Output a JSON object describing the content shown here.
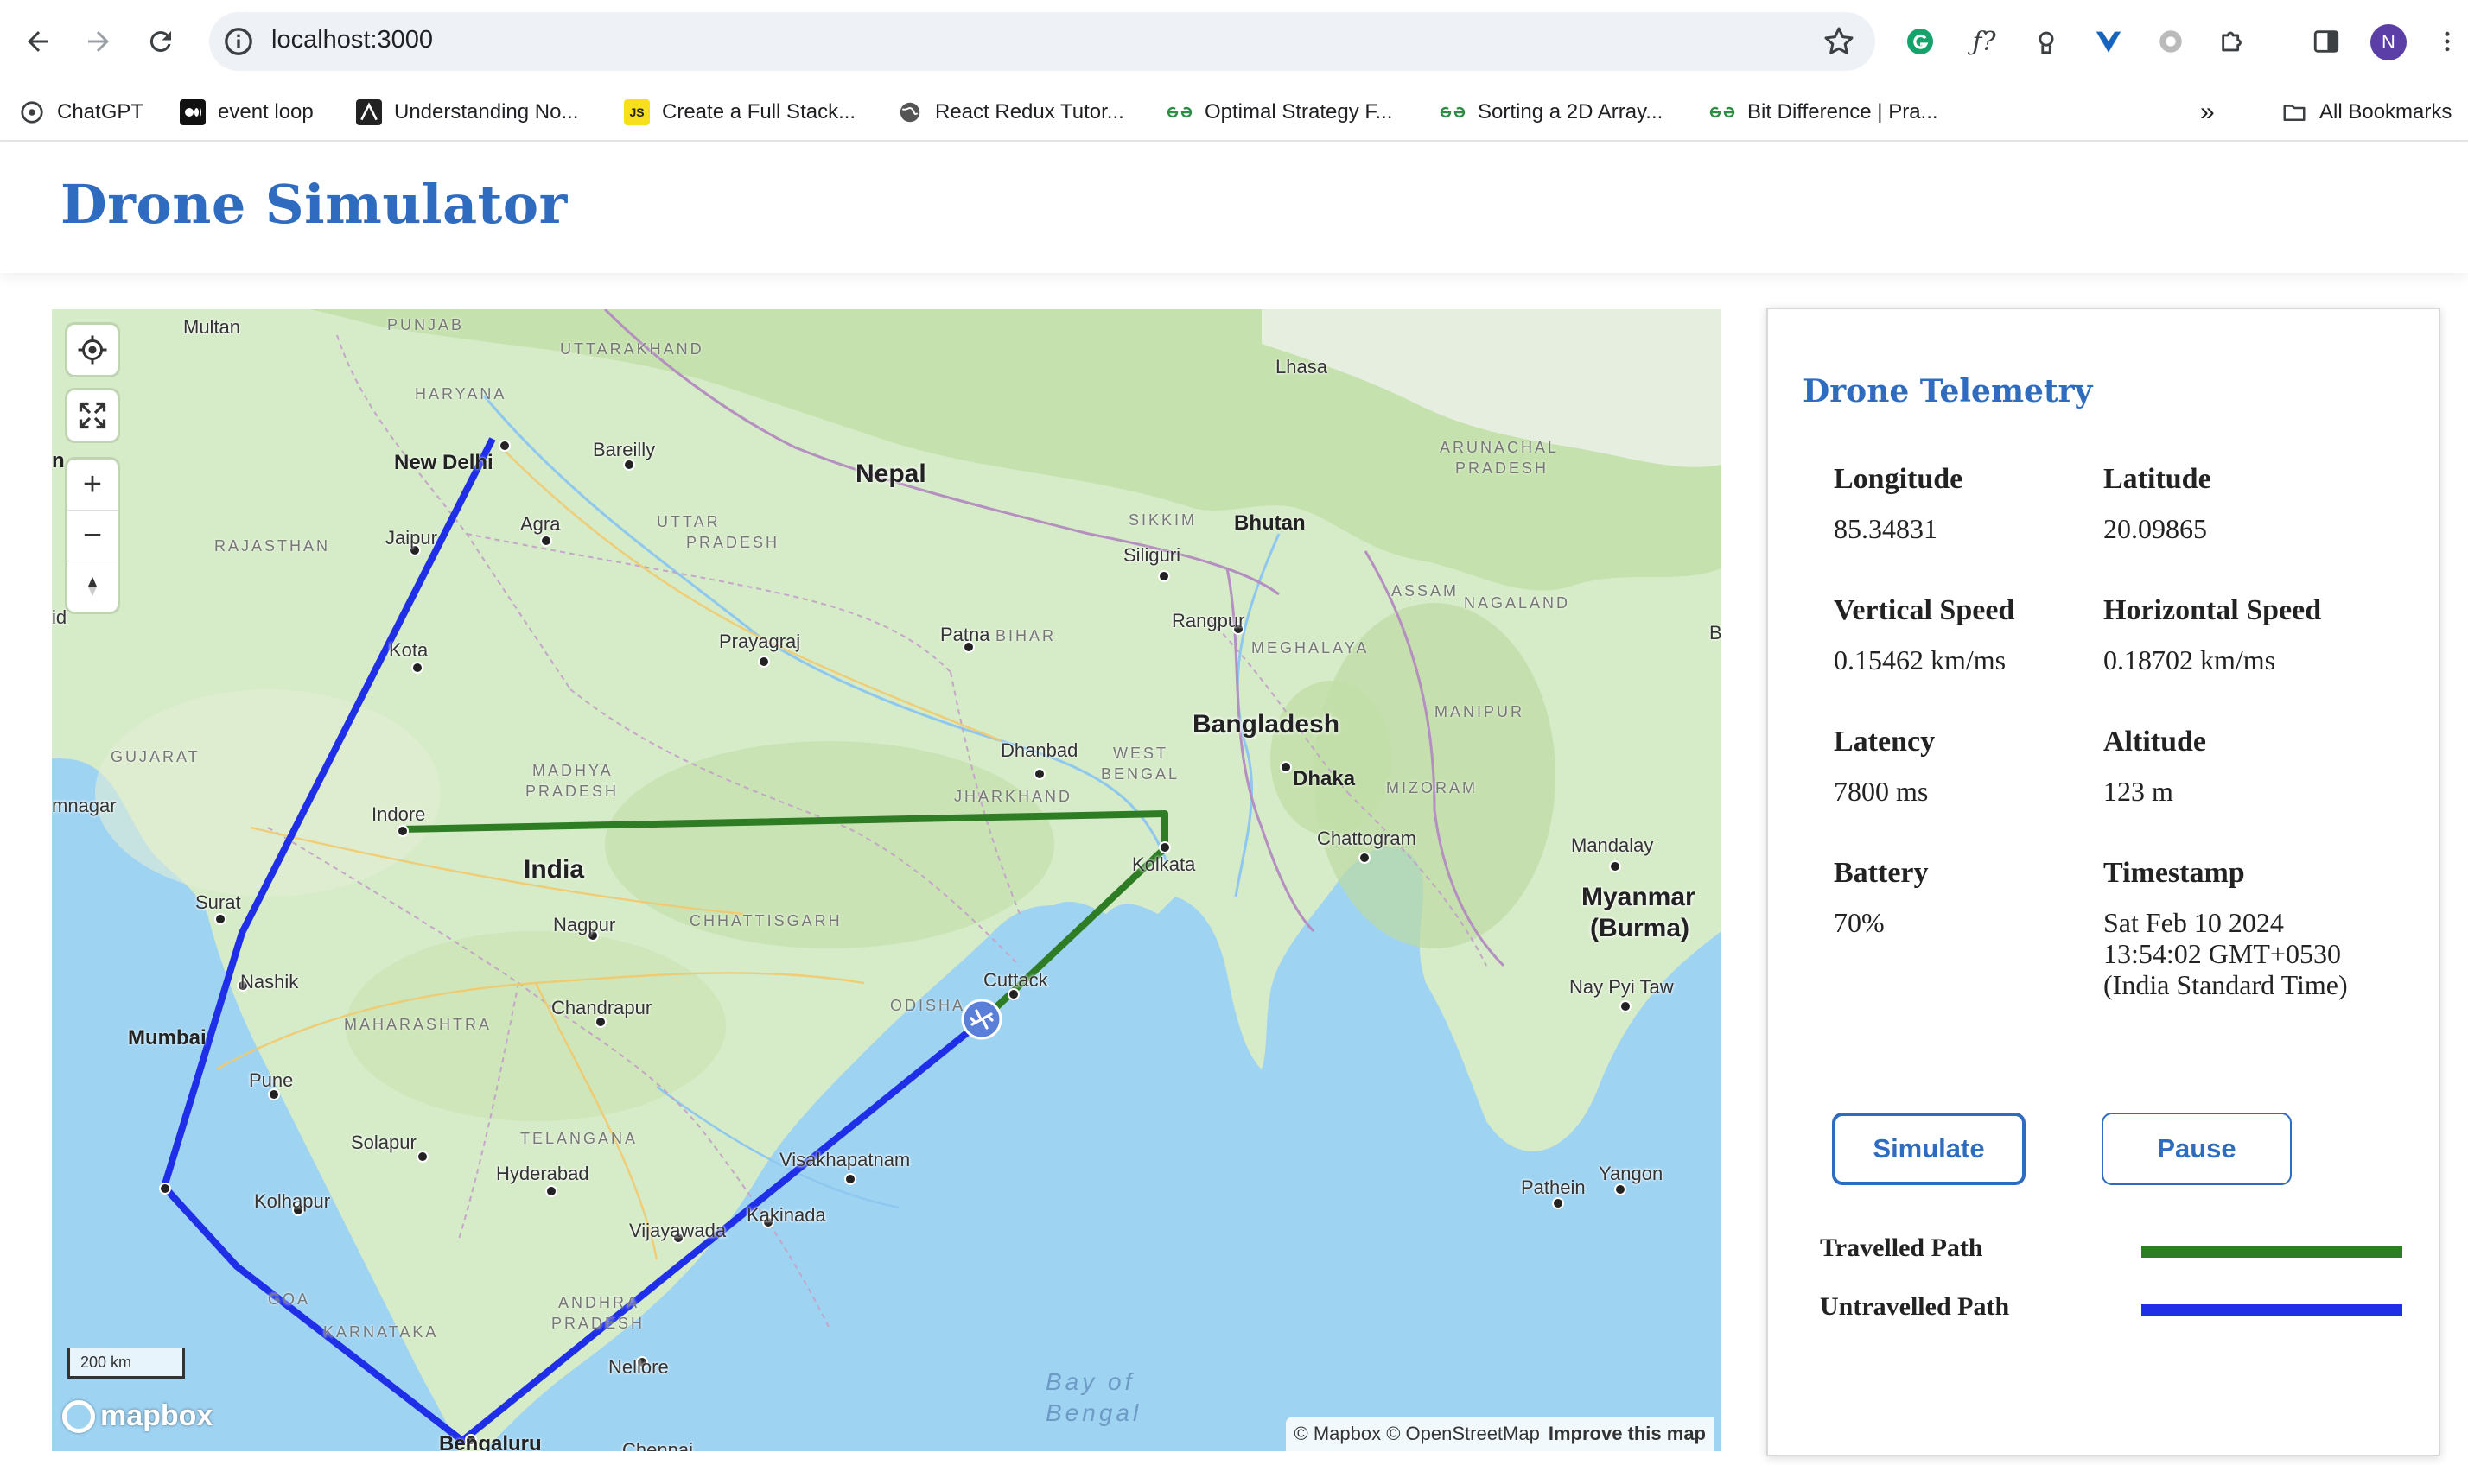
{
  "browser": {
    "url": "localhost:3000",
    "bookmarks": [
      {
        "label": "ChatGPT",
        "icon": "chatgpt-icon"
      },
      {
        "label": "event loop",
        "icon": "medium-icon"
      },
      {
        "label": "Understanding No...",
        "icon": "nodejs-icon"
      },
      {
        "label": "Create a Full Stack...",
        "icon": "js-icon"
      },
      {
        "label": "React Redux Tutor...",
        "icon": "globe-icon"
      },
      {
        "label": "Optimal Strategy F...",
        "icon": "gfg-icon"
      },
      {
        "label": "Sorting a 2D Array...",
        "icon": "gfg-icon"
      },
      {
        "label": "Bit Difference | Pra...",
        "icon": "gfg-icon"
      }
    ],
    "all_bookmarks": "All Bookmarks",
    "js_badge": "JS",
    "profile_initial": "N"
  },
  "app": {
    "title": "Drone Simulator"
  },
  "map": {
    "labels": {
      "multan": "Multan",
      "punjab": "PUNJAB",
      "haryana": "HARYANA",
      "uttarakhand": "UTTARAKHAND",
      "lhasa": "Lhasa",
      "new_delhi": "New Delhi",
      "bareilly": "Bareilly",
      "nepal": "Nepal",
      "arunachal1": "ARUNACHAL",
      "arunachal2": "PRADESH",
      "rajasthan": "RAJASTHAN",
      "jaipur": "Jaipur",
      "agra": "Agra",
      "uttar1": "UTTAR",
      "uttar2": "PRADESH",
      "sikkim": "SIKKIM",
      "bhutan": "Bhutan",
      "siliguri": "Siliguri",
      "assam": "ASSAM",
      "nagaland": "NAGALAND",
      "kota": "Kota",
      "prayagraj": "Prayagraj",
      "patna": "Patna",
      "bihar": "BIHAR",
      "rangpur": "Rangpur",
      "meghalaya": "MEGHALAYA",
      "bangladesh": "Bangladesh",
      "manipur": "MANIPUR",
      "gujarat": "GUJARAT",
      "madhya1": "MADHYA",
      "madhya2": "PRADESH",
      "dhanbad": "Dhanbad",
      "west1": "WEST",
      "west2": "BENGAL",
      "dhaka": "Dhaka",
      "mizoram": "MIZORAM",
      "jamnagar": "mnagar",
      "indore": "Indore",
      "jharkhand": "JHARKHAND",
      "chattogram": "Chattogram",
      "india": "India",
      "kolkata": "Kolkata",
      "mandalay": "Mandalay",
      "surat": "Surat",
      "chhattisgarh": "CHHATTISGARH",
      "nagpur": "Nagpur",
      "myanmar1": "Myanmar",
      "myanmar2": "(Burma)",
      "nashik": "Nashik",
      "cuttack": "Cuttack",
      "chandrapur": "Chandrapur",
      "odisha": "ODISHA",
      "naypyitaw": "Nay Pyi Taw",
      "mumbai": "Mumbai",
      "maharashtra": "MAHARASHTRA",
      "pune": "Pune",
      "solapur": "Solapur",
      "telangana": "TELANGANA",
      "hyderabad": "Hyderabad",
      "visakhapatnam": "Visakhapatnam",
      "pathein": "Pathein",
      "yangon": "Yangon",
      "kolhapur": "Kolhapur",
      "kakinada": "Kakinada",
      "vijayawada": "Vijayawada",
      "goa": "GOA",
      "andhra1": "ANDHRA",
      "andhra2": "PRADESH",
      "karnataka": "KARNATAKA",
      "nellore": "Nellore",
      "bay1": "Bay of",
      "bay2": "Bengal",
      "bengaluru": "Bengaluru",
      "chennai": "Chennai",
      "edge_n": "n",
      "edge_d": "id",
      "edge_b": "B"
    },
    "scale": "200 km",
    "logo": "mapbox",
    "attribution": "© Mapbox © OpenStreetMap",
    "improve": "Improve this map",
    "controls": {
      "zoom_in": "+",
      "zoom_out": "−"
    }
  },
  "telemetry": {
    "title": "Drone Telemetry",
    "longitude": {
      "label": "Longitude",
      "value": "85.34831"
    },
    "latitude": {
      "label": "Latitude",
      "value": "20.09865"
    },
    "vertical_speed": {
      "label": "Vertical Speed",
      "value": "0.15462 km/ms"
    },
    "horizontal_speed": {
      "label": "Horizontal Speed",
      "value": "0.18702 km/ms"
    },
    "latency": {
      "label": "Latency",
      "value": "7800 ms"
    },
    "altitude": {
      "label": "Altitude",
      "value": "123 m"
    },
    "battery": {
      "label": "Battery",
      "value": "70%"
    },
    "timestamp": {
      "label": "Timestamp",
      "value": "Sat Feb 10 2024 13:54:02 GMT+0530 (India Standard Time)"
    },
    "simulate_label": "Simulate",
    "pause_label": "Pause",
    "legend": {
      "travelled": "Travelled Path",
      "untravelled": "Untravelled Path"
    }
  },
  "colors": {
    "title_blue": "#2f6cc0",
    "travelled": "#2e7d24",
    "untravelled": "#1f2fe8"
  }
}
